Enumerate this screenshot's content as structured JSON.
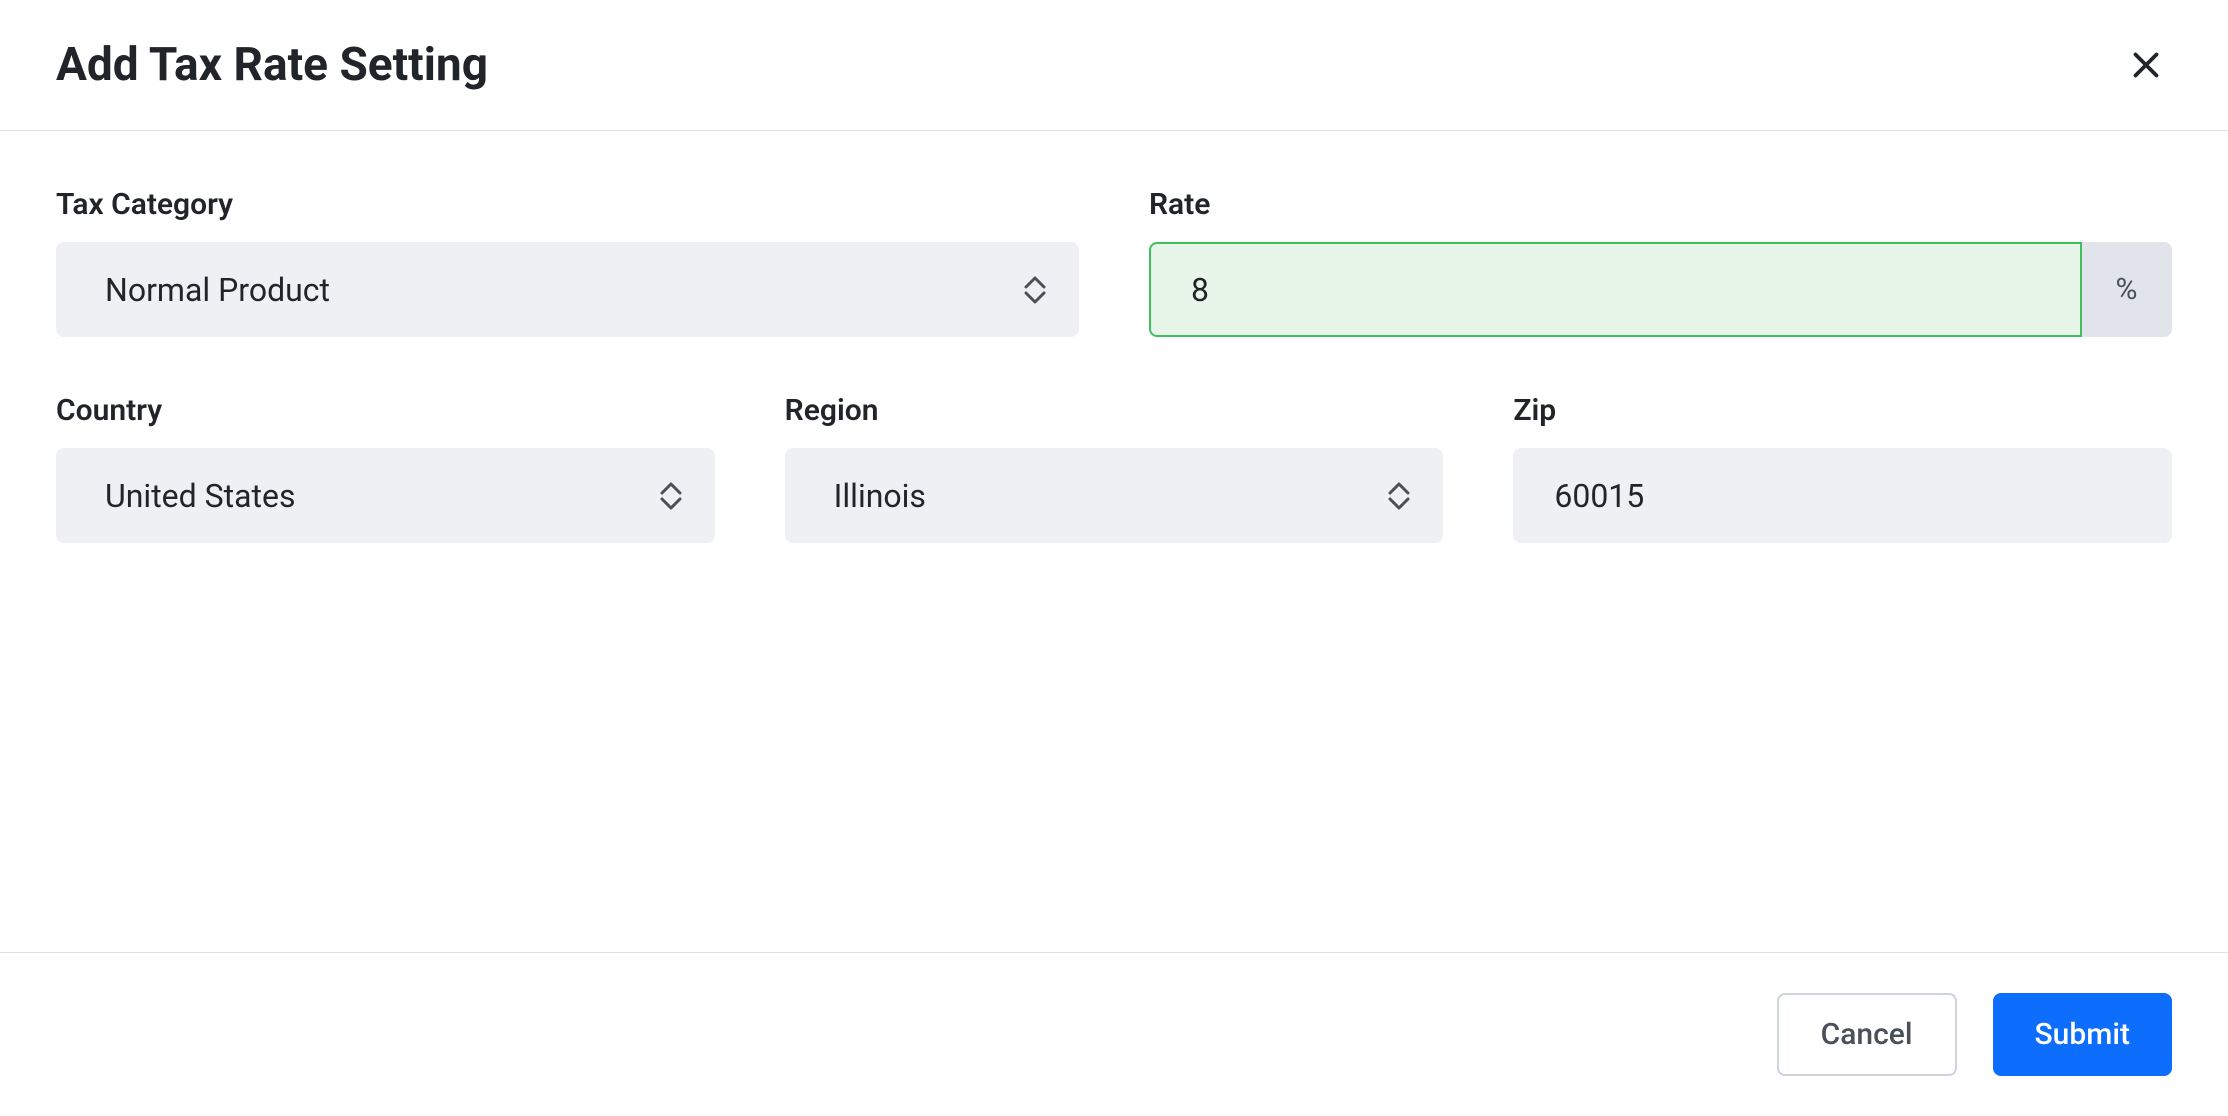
{
  "header": {
    "title": "Add Tax Rate Setting"
  },
  "form": {
    "tax_category": {
      "label": "Tax Category",
      "value": "Normal Product"
    },
    "rate": {
      "label": "Rate",
      "value": "8",
      "suffix": "%"
    },
    "country": {
      "label": "Country",
      "value": "United States"
    },
    "region": {
      "label": "Region",
      "value": "Illinois"
    },
    "zip": {
      "label": "Zip",
      "value": "60015"
    }
  },
  "footer": {
    "cancel_label": "Cancel",
    "submit_label": "Submit"
  }
}
